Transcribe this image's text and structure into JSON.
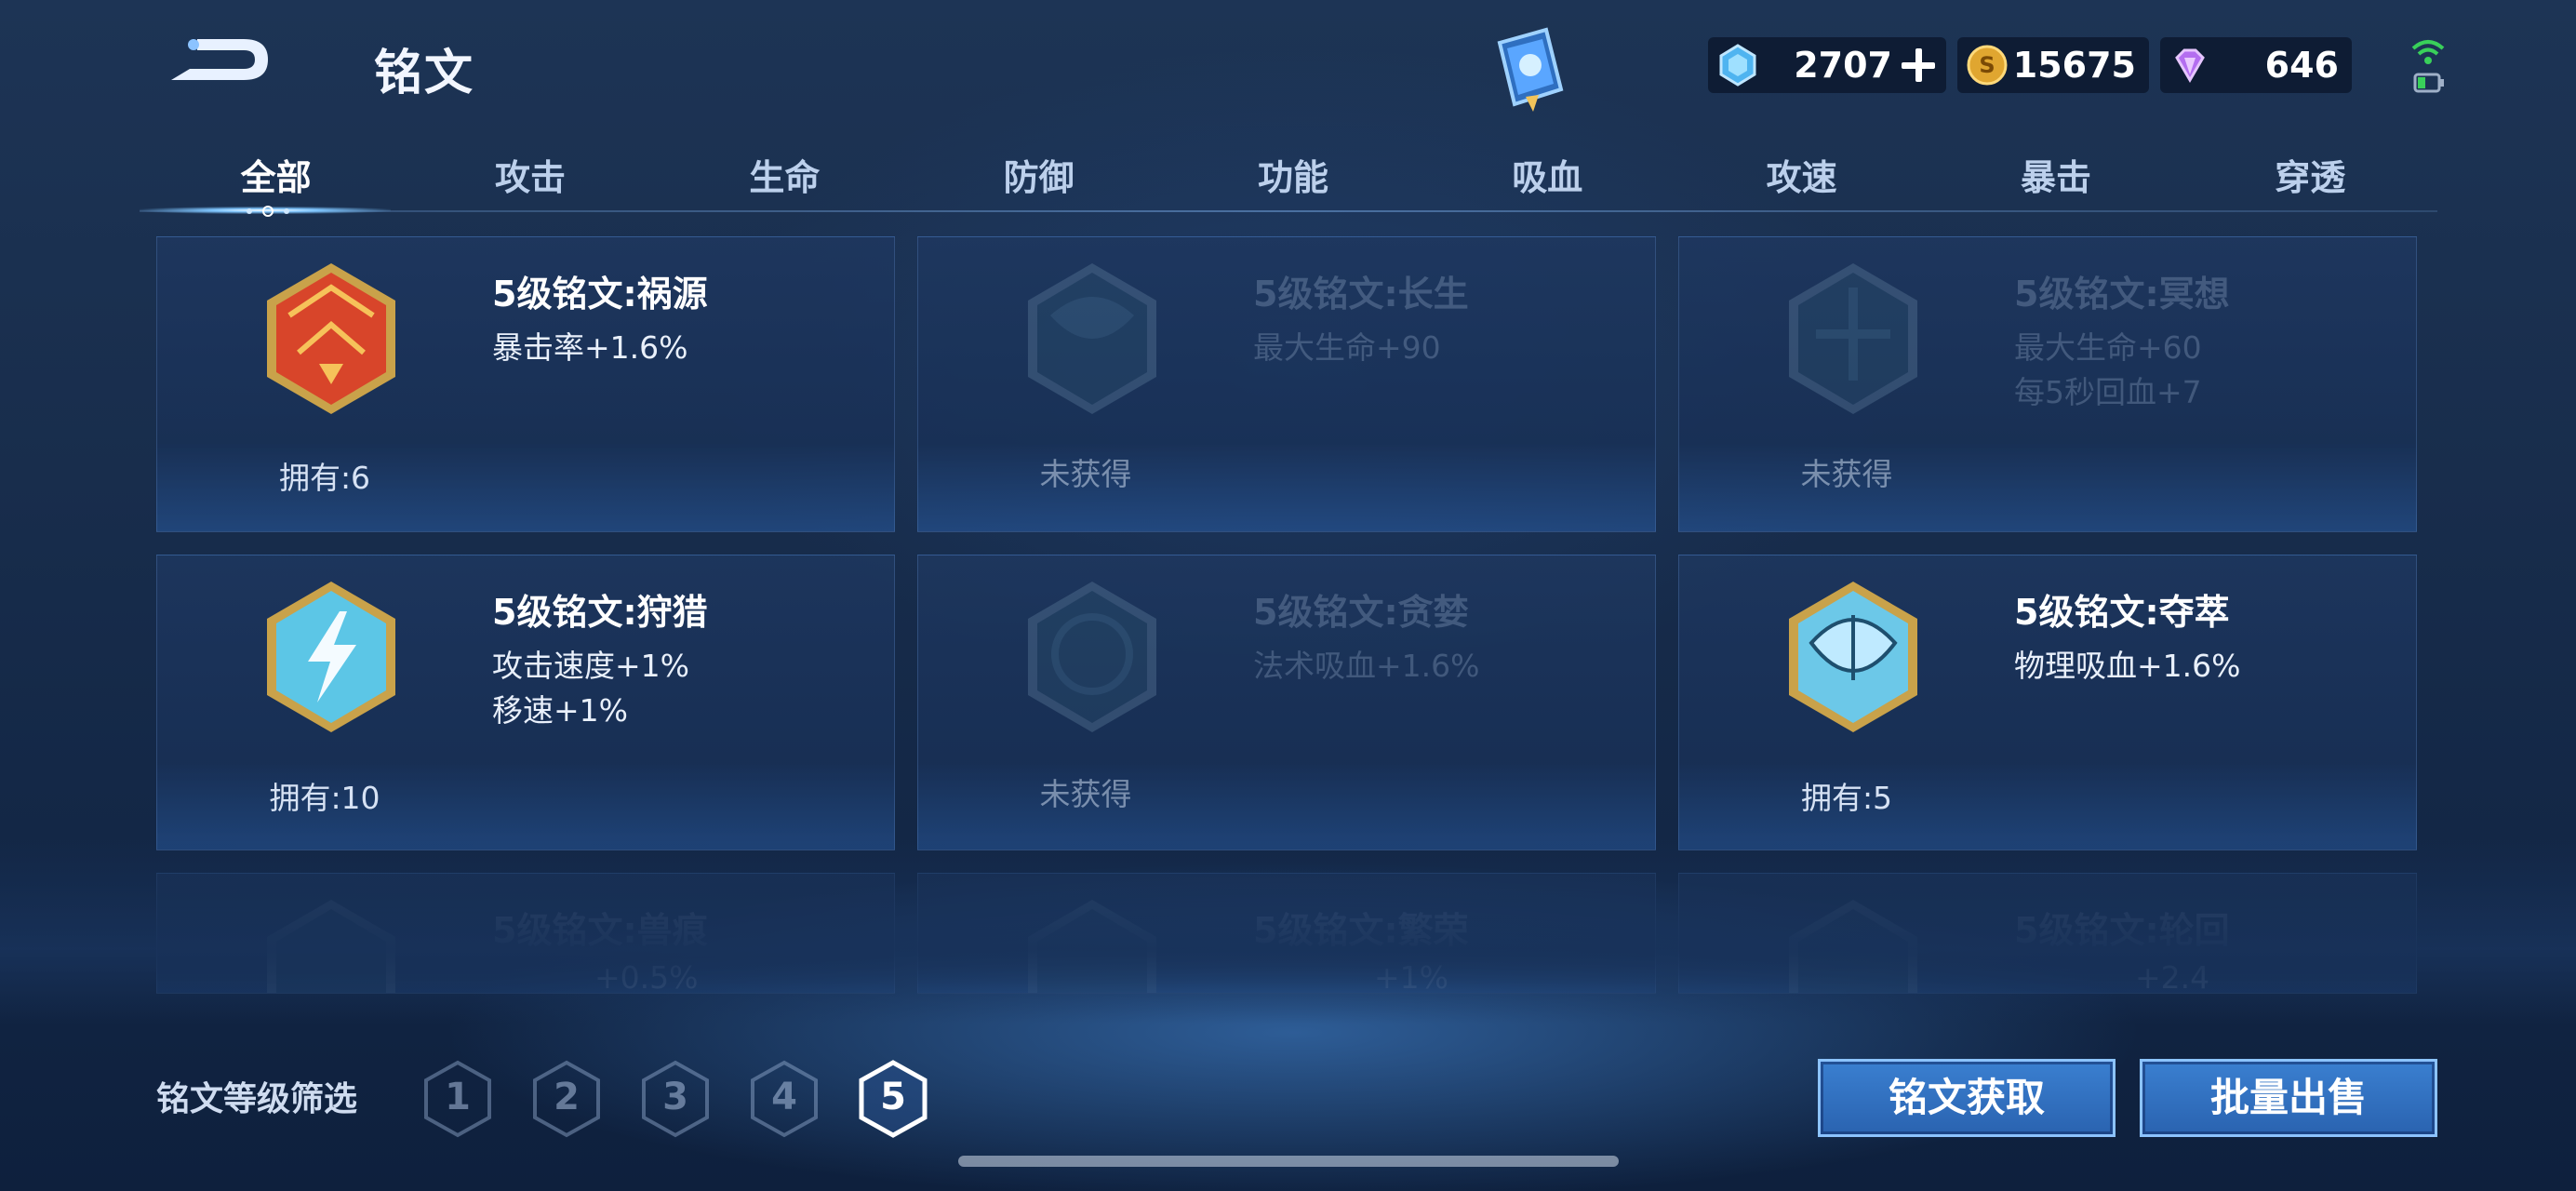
{
  "header": {
    "title": "铭文",
    "currencies": [
      {
        "name": "diamond-coupon",
        "value": "2707",
        "icon": "blue-gem-icon",
        "has_plus": true
      },
      {
        "name": "gold",
        "value": "15675",
        "icon": "gold-coin-icon",
        "has_plus": false
      },
      {
        "name": "gem",
        "value": "646",
        "icon": "purple-crystal-icon",
        "has_plus": false
      }
    ]
  },
  "tabs": [
    "全部",
    "攻击",
    "生命",
    "防御",
    "功能",
    "吸血",
    "攻速",
    "暴击",
    "穿透"
  ],
  "active_tab": "全部",
  "cards": [
    {
      "name": "5级铭文:祸源",
      "stats": [
        "暴击率+1.6%"
      ],
      "owned": "拥有:6",
      "obtained": true,
      "emblem": "red-emblem-icon"
    },
    {
      "name": "5级铭文:长生",
      "stats": [
        "最大生命+90"
      ],
      "owned": "未获得",
      "obtained": false,
      "emblem": "teal-emblem-icon"
    },
    {
      "name": "5级铭文:冥想",
      "stats": [
        "最大生命+60",
        "每5秒回血+7"
      ],
      "owned": "未获得",
      "obtained": false,
      "emblem": "teal-emblem-icon"
    },
    {
      "name": "5级铭文:狩猎",
      "stats": [
        "攻击速度+1%",
        "移速+1%"
      ],
      "owned": "拥有:10",
      "obtained": true,
      "emblem": "lightning-emblem-icon"
    },
    {
      "name": "5级铭文:贪婪",
      "stats": [
        "法术吸血+1.6%"
      ],
      "owned": "未获得",
      "obtained": false,
      "emblem": "teal-emblem-icon"
    },
    {
      "name": "5级铭文:夺萃",
      "stats": [
        "物理吸血+1.6%"
      ],
      "owned": "拥有:5",
      "obtained": true,
      "emblem": "leaf-emblem-icon"
    },
    {
      "name": "5级铭文:兽痕",
      "stats": [
        "+0.5%"
      ],
      "owned": "",
      "obtained": false,
      "emblem": "teal-emblem-icon"
    },
    {
      "name": "5级铭文:繁荣",
      "stats": [
        "+1%"
      ],
      "owned": "",
      "obtained": false,
      "emblem": "teal-emblem-icon"
    },
    {
      "name": "5级铭文:轮回",
      "stats": [
        "+2.4"
      ],
      "owned": "",
      "obtained": false,
      "emblem": "teal-emblem-icon"
    }
  ],
  "filter": {
    "label": "铭文等级筛选",
    "levels": [
      "1",
      "2",
      "3",
      "4",
      "5"
    ],
    "active_level": "5"
  },
  "actions": {
    "acquire_label": "铭文获取",
    "sell_label": "批量出售"
  },
  "colors": {
    "accent": "#8cc3ff",
    "button_fill": "#2a63b0",
    "gold_frame": "#c9a24a"
  }
}
